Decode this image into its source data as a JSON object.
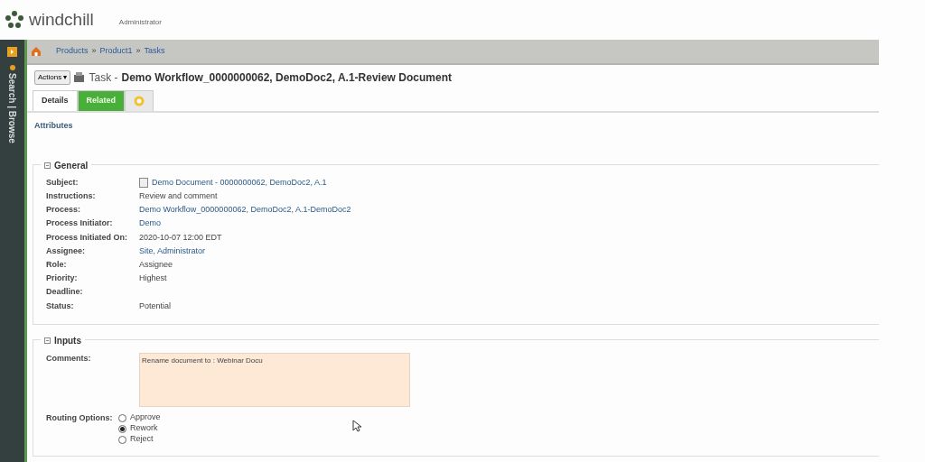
{
  "header": {
    "product": "windchill",
    "user": "Administrator"
  },
  "sidebar": {
    "label": "Search | Browse"
  },
  "breadcrumb": [
    "Products",
    "Product1",
    "Tasks"
  ],
  "breadcrumb_separator": "»",
  "page": {
    "actions": "Actions ▾",
    "title_prefix": "Task -",
    "title": "Demo Workflow_0000000062, DemoDoc2, A.1-Review Document"
  },
  "tabs": [
    {
      "label": "Details",
      "kind": "text",
      "selected": true
    },
    {
      "label": "Related",
      "kind": "text",
      "selected": false
    },
    {
      "kind": "icon",
      "selected": false
    }
  ],
  "section_label": "Attributes",
  "general": {
    "title": "General",
    "fields": [
      {
        "label": "Subject:",
        "value": "Demo Document - 0000000062, DemoDoc2, A.1",
        "kind": "doc-link"
      },
      {
        "label": "Instructions:",
        "value": "Review and comment",
        "kind": "text"
      },
      {
        "label": "Process:",
        "value": "Demo Workflow_0000000062, DemoDoc2, A.1-DemoDoc2",
        "kind": "link"
      },
      {
        "label": "Process Initiator:",
        "value": "Demo",
        "kind": "link"
      },
      {
        "label": "Process Initiated On:",
        "value": "2020-10-07 12:00 EDT",
        "kind": "text"
      },
      {
        "label": "Assignee:",
        "value": "Site, Administrator",
        "kind": "link"
      },
      {
        "label": "Role:",
        "value": "Assignee",
        "kind": "text"
      },
      {
        "label": "Priority:",
        "value": "Highest",
        "kind": "text"
      },
      {
        "label": "Deadline:"
      },
      {
        "label": "Status:",
        "value": "Potential",
        "kind": "text"
      }
    ]
  },
  "inputs": {
    "title": "Inputs",
    "comments_label": "Comments:",
    "comments": "Rename document to : Webinar Docu",
    "routing_label": "Routing Options:",
    "options": [
      {
        "label": "Approve",
        "selected": false
      },
      {
        "label": "Rework",
        "selected": true
      },
      {
        "label": "Reject",
        "selected": false
      }
    ]
  }
}
